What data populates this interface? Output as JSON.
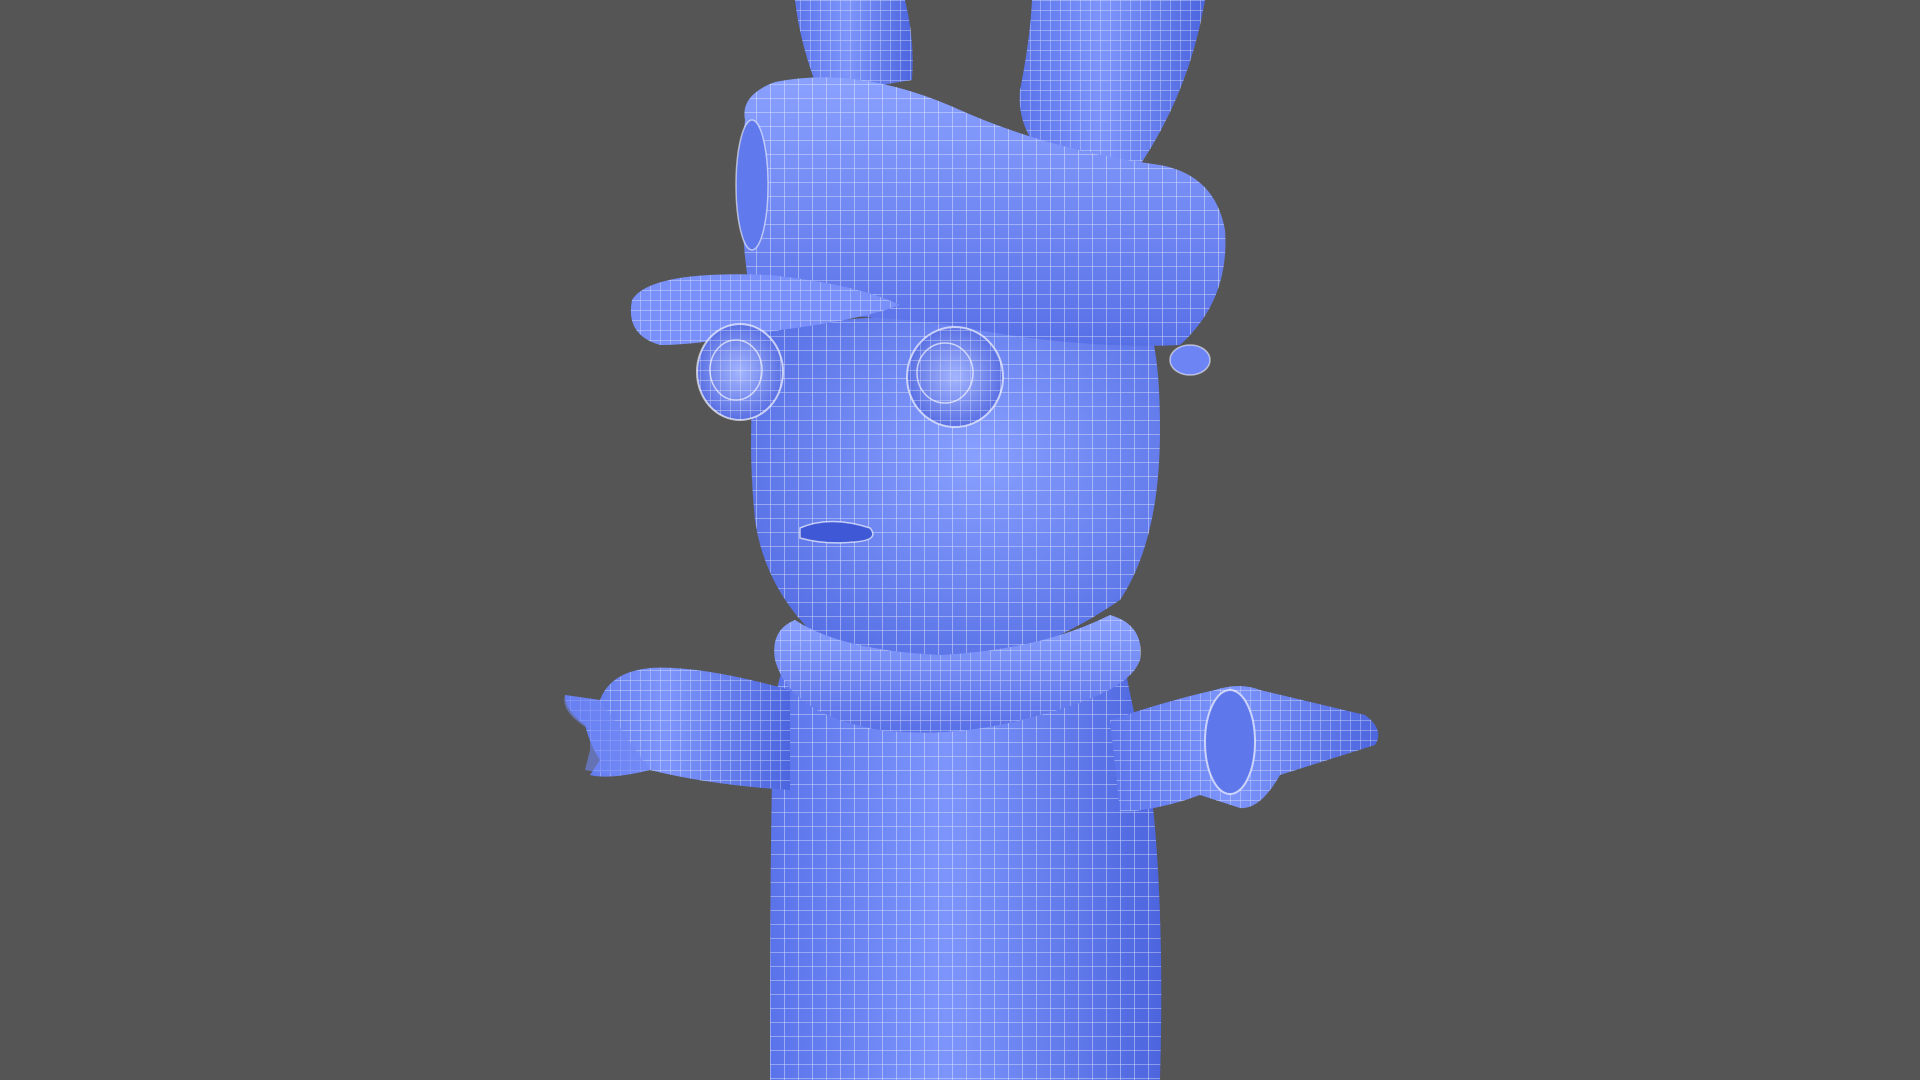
{
  "scene": {
    "background_color": "#555555",
    "mesh_fill_color": "#6b84f2",
    "mesh_shadow_color": "#3f58d6",
    "mesh_highlight_color": "#a9b9ff",
    "wire_color": "#f3f5ff",
    "display_mode": "wireframe-on-shaded",
    "subject": "rabbit-character-mesh"
  }
}
